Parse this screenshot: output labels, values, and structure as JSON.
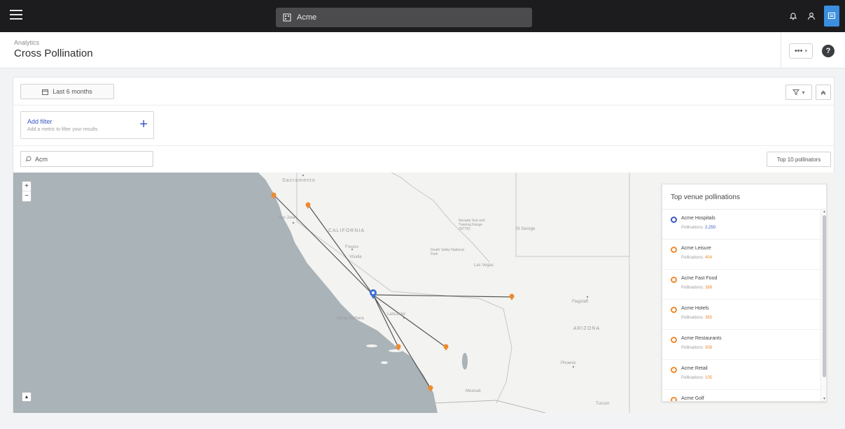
{
  "topbar": {
    "org_name": "Acme",
    "accent": "#3b8ee0"
  },
  "header": {
    "breadcrumb": "Analytics",
    "title": "Cross Pollination",
    "more_label": "•••"
  },
  "toolbar": {
    "date_range": "Last 6 months",
    "add_filter_title": "Add filter",
    "add_filter_subtitle": "Add a metric to filter your results",
    "search_value": "Acm",
    "top_button": "Top 10 pollinators"
  },
  "map": {
    "labels": {
      "sacramento": "Sacramento",
      "california": "CALIFORNIA",
      "san_jose": "San Jose",
      "fresno": "Fresno",
      "las_vegas": "Las Vegas",
      "flagstaff": "Flagstaff",
      "arizona": "ARIZONA",
      "phoenix": "Phoenix",
      "santa_barbara": "Santa Barbara",
      "lancaster": "Lancaster",
      "mexicali": "Mexicali",
      "tucson": "Tucson",
      "st_george": "St George",
      "visalia": "Visalia",
      "death_valley": "Death Valley National Park",
      "nevada_test": "Nevada Test and Training Range (NTTR)"
    },
    "colors": {
      "hub": "#3a6fd8",
      "pin": "#ee8a2e",
      "land": "#f3f3f1",
      "water": "#a9b3b8",
      "line": "#555555"
    }
  },
  "panel": {
    "title": "Top venue pollinations",
    "stat_label": "Pollinations:",
    "venues": [
      {
        "name": "Acme Hospitals",
        "count": "2,250",
        "color": "#3a55c4"
      },
      {
        "name": "Acme Leisure",
        "count": "404",
        "color": "#ee8a2e"
      },
      {
        "name": "Acme Fast Food",
        "count": "389",
        "color": "#ee8a2e"
      },
      {
        "name": "Acme Hotels",
        "count": "365",
        "color": "#ee8a2e"
      },
      {
        "name": "Acme Restaurants",
        "count": "308",
        "color": "#ee8a2e"
      },
      {
        "name": "Acme Retail",
        "count": "105",
        "color": "#ee8a2e"
      },
      {
        "name": "Acme Golf",
        "count": "",
        "color": "#ee8a2e"
      }
    ]
  }
}
